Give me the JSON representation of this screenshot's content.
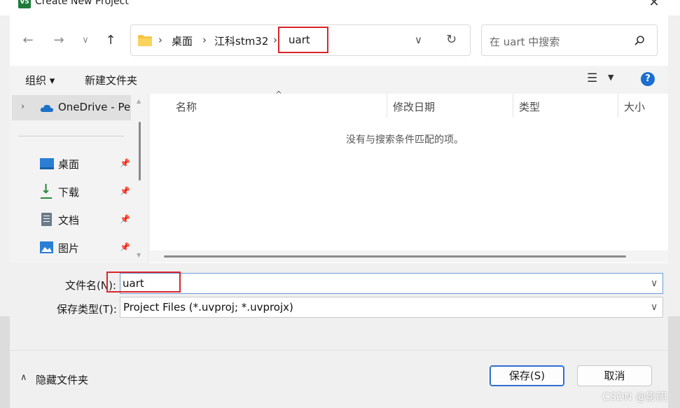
{
  "window": {
    "title": "Create New Project",
    "app_icon_text": "V5"
  },
  "nav": {
    "breadcrumb": [
      "桌面",
      "江科stm32",
      "uart"
    ],
    "search_placeholder": "在 uart 中搜索"
  },
  "toolbar": {
    "organize_label": "组织 ▾",
    "new_folder_label": "新建文件夹"
  },
  "sidebar": {
    "onedrive_label": "OneDrive - Per",
    "items": [
      {
        "label": "桌面",
        "icon": "desktop-icon",
        "color": "#2a7fd4"
      },
      {
        "label": "下载",
        "icon": "download-icon",
        "color": "#2a8a3c"
      },
      {
        "label": "文档",
        "icon": "document-icon",
        "color": "#6a7a8a"
      },
      {
        "label": "图片",
        "icon": "picture-icon",
        "color": "#2a7fd4"
      }
    ]
  },
  "file_list": {
    "columns": [
      "名称",
      "修改日期",
      "类型",
      "大小"
    ],
    "empty_message": "没有与搜索条件匹配的项。"
  },
  "form": {
    "filename_label": "文件名(N):",
    "filename_value": "uart",
    "filetype_label": "保存类型(T):",
    "filetype_value": "Project Files (*.uvproj; *.uvprojx)"
  },
  "footer": {
    "hide_folders_label": "隐藏文件夹",
    "save_label": "保存(S)",
    "cancel_label": "取消"
  },
  "watermark": "CSDN @影阴"
}
